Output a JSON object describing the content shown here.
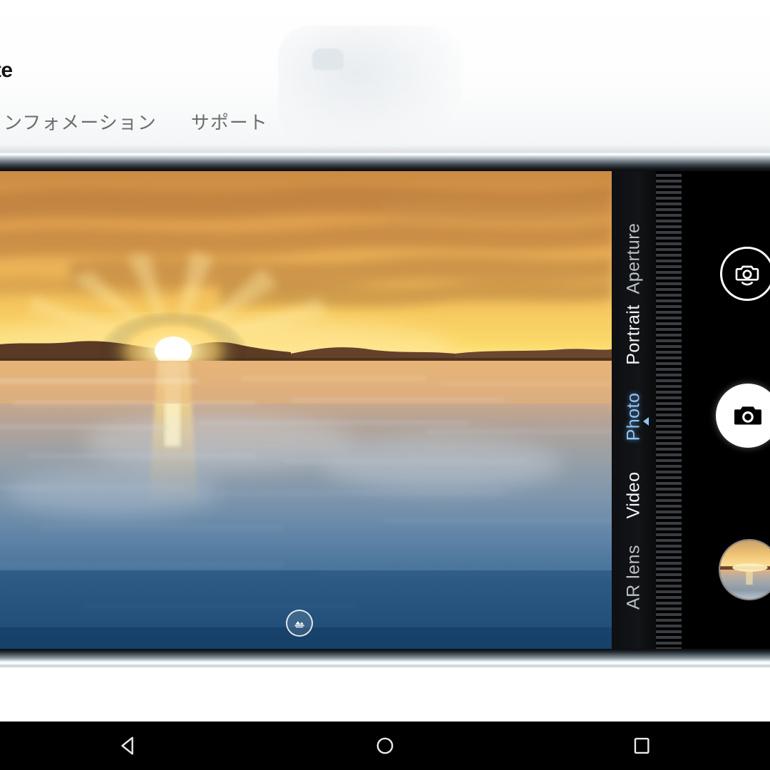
{
  "page": {
    "site_title": "ite",
    "nav": [
      {
        "label": "インフォメーション"
      },
      {
        "label": "サポート"
      }
    ],
    "watermark": "faint-logo-watermark"
  },
  "phone": {
    "device": "smartphone-landscape",
    "camera_app": {
      "viewfinder": {
        "scene": "sunset-over-water",
        "scene_badge_icon": "ai-scene-detect-icon"
      },
      "modes": [
        {
          "label": "Aperture",
          "active": false
        },
        {
          "label": "Portrait",
          "active": false
        },
        {
          "label": "Photo",
          "active": true
        },
        {
          "label": "Video",
          "active": false
        },
        {
          "label": "AR lens",
          "active": false
        }
      ],
      "active_mode": "Photo",
      "controls": [
        {
          "name": "switch-camera-button",
          "icon": "camera-switch-icon"
        },
        {
          "name": "shutter-button",
          "icon": "camera-icon"
        },
        {
          "name": "gallery-thumbnail-button",
          "icon": "photo-thumbnail"
        }
      ],
      "ruler": "zoom-exposure-tick-scale"
    }
  },
  "android_nav": {
    "buttons": [
      {
        "name": "back-button",
        "icon": "triangle-back-icon"
      },
      {
        "name": "home-button",
        "icon": "circle-home-icon"
      },
      {
        "name": "recents-button",
        "icon": "square-recents-icon"
      }
    ]
  },
  "colors": {
    "active_mode": "#8fc4f5",
    "mode_label": "#f2f4f6",
    "nav_text": "#6d6d6d",
    "title_text": "#151515",
    "panel_bg": "#000000"
  },
  "chart_data": null
}
